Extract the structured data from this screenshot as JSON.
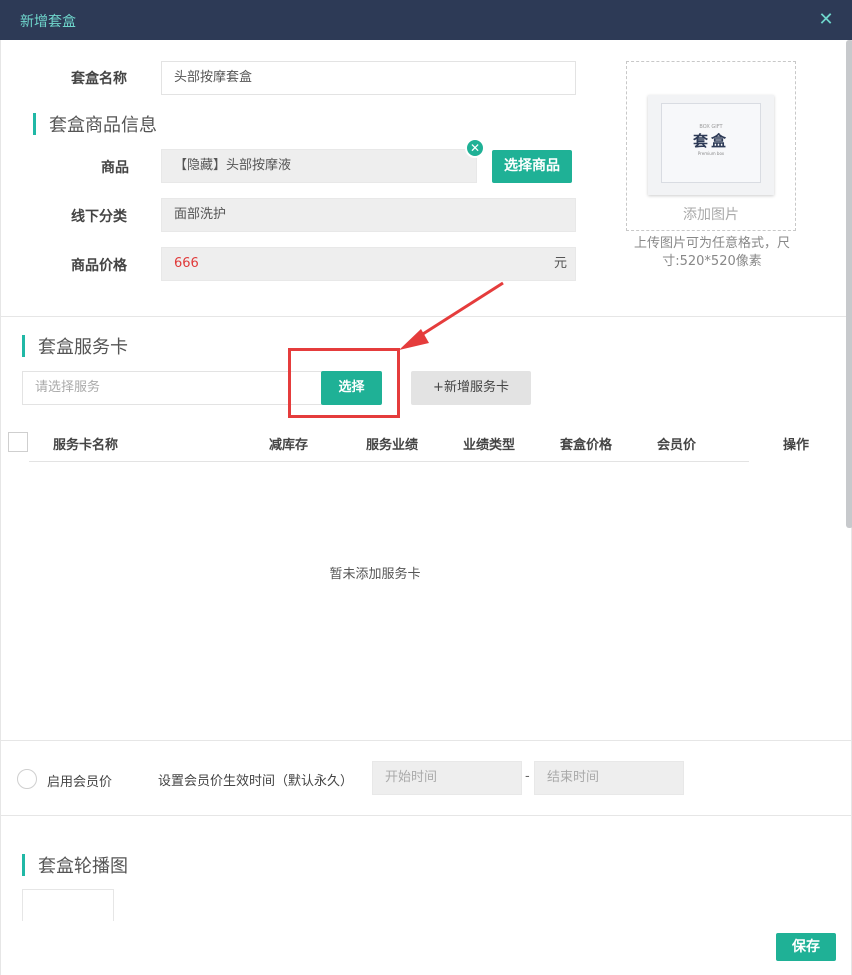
{
  "window": {
    "title": "新增套盒",
    "close_icon": "close-icon"
  },
  "form": {
    "name_label": "套盒名称",
    "name_value": "头部按摩套盒",
    "product_section_title": "套盒商品信息",
    "product_label": "商品",
    "product_value": "【隐藏】头部按摩液",
    "select_product_button": "选择商品",
    "offline_category_label": "线下分类",
    "offline_category_value": "面部洗护",
    "price_label": "商品价格",
    "price_value": "666",
    "price_unit": "元"
  },
  "upload": {
    "image_top_text": "BOX GIFT",
    "image_main_text": "套盒",
    "image_sub_text": "Premium box",
    "add_label": "添加图片",
    "hint": "上传图片可为任意格式，尺寸:520*520像素"
  },
  "service_card": {
    "section_title": "套盒服务卡",
    "select_placeholder": "请选择服务",
    "select_button": "选择",
    "add_button": "+新增服务卡",
    "columns": [
      "服务卡名称",
      "减库存",
      "服务业绩",
      "业绩类型",
      "套盒价格",
      "会员价",
      "操作"
    ],
    "empty_text": "暂未添加服务卡"
  },
  "member_price": {
    "enable_label": "启用会员价",
    "period_label": "设置会员价生效时间（默认永久）",
    "start_placeholder": "开始时间",
    "separator": "-",
    "end_placeholder": "结束时间"
  },
  "carousel": {
    "section_title": "套盒轮播图"
  },
  "footer": {
    "save_button": "保存"
  },
  "colors": {
    "accent": "#1fb196",
    "header": "#2d3a56",
    "annotation": "#e53c3c",
    "price": "#e03a3a"
  }
}
